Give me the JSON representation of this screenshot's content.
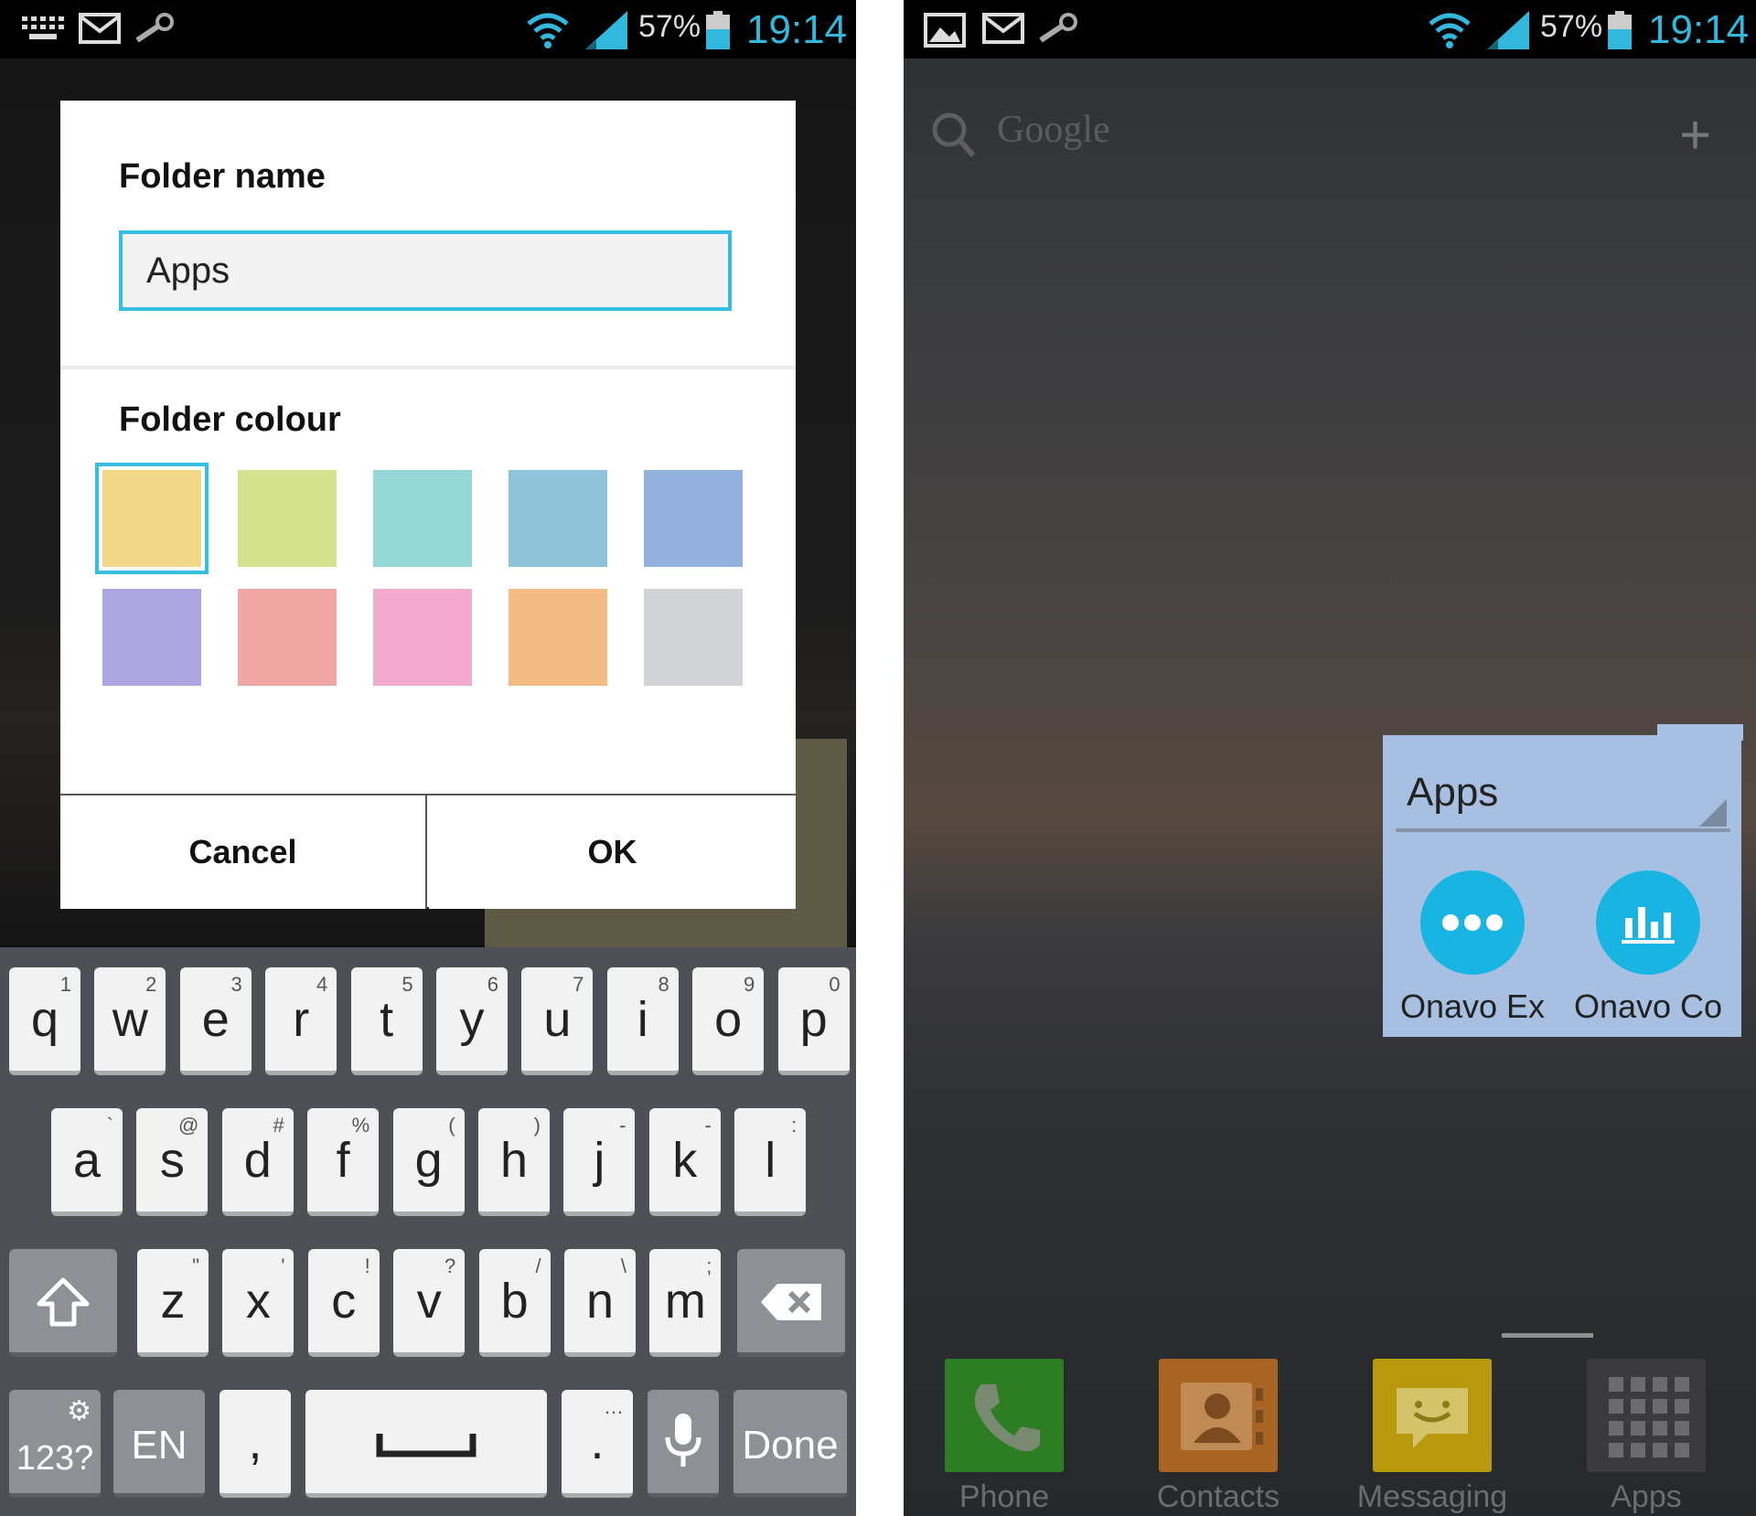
{
  "status_bar": {
    "battery": "57%",
    "time": "19:14",
    "battery_level": 0.57
  },
  "dialog": {
    "folder_name_label": "Folder name",
    "folder_name_value": "Apps",
    "folder_colour_label": "Folder colour",
    "colours": [
      "#f2d98a",
      "#d4e18f",
      "#95d7d4",
      "#8ec3d9",
      "#93b1dc",
      "#ada5e0",
      "#f0a6a4",
      "#f2abcc",
      "#f2bd85",
      "#d0d2d6"
    ],
    "selected_colour_index": 0,
    "cancel_label": "Cancel",
    "ok_label": "OK"
  },
  "keyboard": {
    "row1": [
      {
        "k": "q",
        "s": "1"
      },
      {
        "k": "w",
        "s": "2"
      },
      {
        "k": "e",
        "s": "3"
      },
      {
        "k": "r",
        "s": "4"
      },
      {
        "k": "t",
        "s": "5"
      },
      {
        "k": "y",
        "s": "6"
      },
      {
        "k": "u",
        "s": "7"
      },
      {
        "k": "i",
        "s": "8"
      },
      {
        "k": "o",
        "s": "9"
      },
      {
        "k": "p",
        "s": "0"
      }
    ],
    "row2": [
      {
        "k": "a",
        "s": "`"
      },
      {
        "k": "s",
        "s": "@"
      },
      {
        "k": "d",
        "s": "#"
      },
      {
        "k": "f",
        "s": "%"
      },
      {
        "k": "g",
        "s": "("
      },
      {
        "k": "h",
        "s": ")"
      },
      {
        "k": "j",
        "s": "-"
      },
      {
        "k": "k",
        "s": "-"
      },
      {
        "k": "l",
        "s": ":"
      }
    ],
    "row3": [
      {
        "k": "z",
        "s": "\""
      },
      {
        "k": "x",
        "s": "'"
      },
      {
        "k": "c",
        "s": "!"
      },
      {
        "k": "v",
        "s": "?"
      },
      {
        "k": "b",
        "s": "/"
      },
      {
        "k": "n",
        "s": "\\"
      },
      {
        "k": "m",
        "s": ";"
      }
    ],
    "symbols_label": "123?",
    "language_label": "EN",
    "comma_label": ",",
    "period_label": ".",
    "done_label": "Done"
  },
  "home": {
    "search_placeholder": "Google",
    "folder": {
      "title": "Apps",
      "apps": [
        {
          "label": "Onavo Ex",
          "icon": "dots-icon"
        },
        {
          "label": "Onavo Co",
          "icon": "bar-chart-icon"
        }
      ]
    },
    "dock": [
      {
        "label": "Phone",
        "icon": "phone-icon",
        "color": "#2d7d23"
      },
      {
        "label": "Contacts",
        "icon": "contacts-icon",
        "color": "#a86423"
      },
      {
        "label": "Messaging",
        "icon": "messaging-icon",
        "color": "#b8980c"
      },
      {
        "label": "Apps",
        "icon": "apps-grid-icon",
        "color": "#3b3b3d"
      }
    ]
  }
}
